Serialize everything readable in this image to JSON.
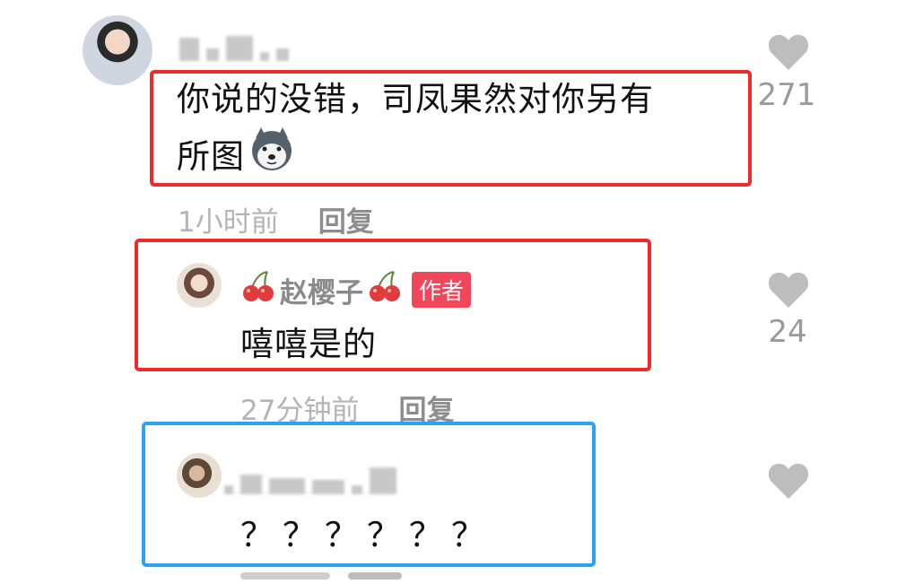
{
  "comments": [
    {
      "text": "你说的没错，司凤果然对你另有所图",
      "line1": "你说的没错，司凤果然对你另有",
      "line2": "所图",
      "emoji_icon": "husky-dog-emoji",
      "time": "1小时前",
      "reply_label": "回复",
      "likes": "271"
    },
    {
      "author": "赵樱子",
      "author_emoji": "cherry-icon",
      "badge": "作者",
      "text": "嘻嘻是的",
      "time": "27分钟前",
      "reply_label": "回复",
      "likes": "24"
    },
    {
      "text": "？？？？？？"
    }
  ],
  "colors": {
    "red_box": "#ee2a2a",
    "blue_box": "#2aa3f0",
    "badge": "#f2465a",
    "like_gray": "#bdbdbd"
  }
}
